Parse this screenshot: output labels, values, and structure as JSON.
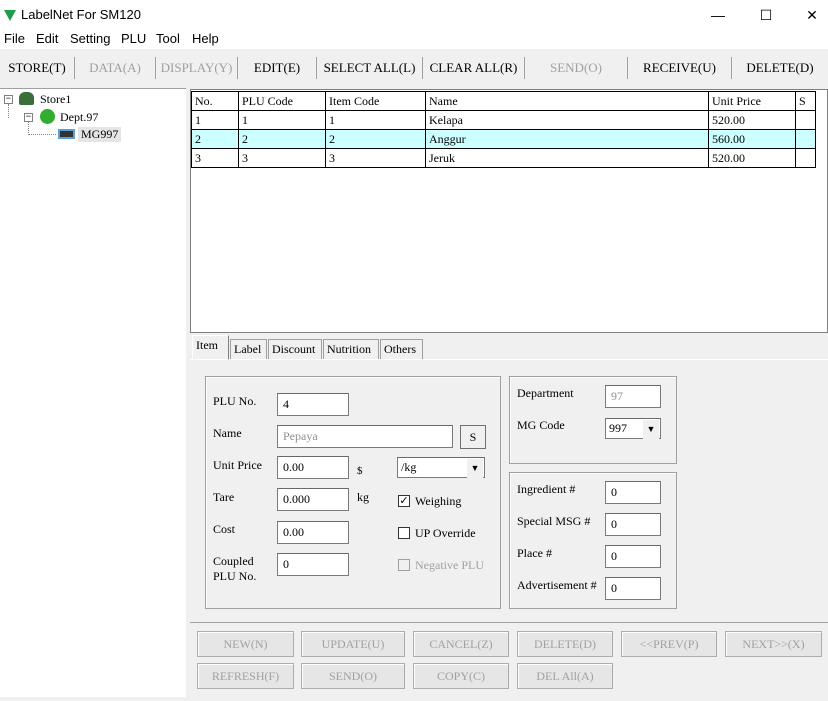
{
  "window": {
    "title": "LabelNet For SM120",
    "min": "—",
    "max": "☐",
    "close": "✕"
  },
  "menu": [
    "File",
    "Edit",
    "Setting",
    "PLU",
    "Tool",
    "Help"
  ],
  "toolbar": {
    "store": "STORE(T)",
    "data": "DATA(A)",
    "display": "DISPLAY(Y)",
    "edit": "EDIT(E)",
    "select_all": "SELECT ALL(L)",
    "clear_all": "CLEAR ALL(R)",
    "send": "SEND(O)",
    "receive": "RECEIVE(U)",
    "delete": "DELETE(D)"
  },
  "tree": {
    "store": "Store1",
    "dept": "Dept.97",
    "mg": "MG997"
  },
  "table": {
    "headers": [
      "No.",
      "PLU Code",
      "Item Code",
      "Name",
      "Unit Price",
      "S"
    ],
    "rows": [
      [
        "1",
        "1",
        "1",
        "Kelapa",
        "520.00",
        ""
      ],
      [
        "2",
        "2",
        "2",
        "Anggur",
        "560.00",
        ""
      ],
      [
        "3",
        "3",
        "3",
        "Jeruk",
        "520.00",
        ""
      ]
    ],
    "selected_row": 1,
    "selected_color": "#ccffff"
  },
  "tabs": [
    "Item",
    "Label",
    "Discount",
    "Nutrition",
    "Others"
  ],
  "form": {
    "plu_no_label": "PLU No.",
    "plu_no": "4",
    "name_label": "Name",
    "name": "Pepaya",
    "name_s": "S",
    "unit_price_label": "Unit Price",
    "unit_price": "0.00",
    "currency": "$",
    "unit": "/kg",
    "tare_label": "Tare",
    "tare": "0.000",
    "tare_unit": "kg",
    "cost_label": "Cost",
    "cost": "0.00",
    "coupled_label_1": "Coupled",
    "coupled_label_2": "PLU No.",
    "coupled": "0",
    "weighing_label": "Weighing",
    "weighing_checked": true,
    "check_mark": "✓",
    "up_override_label": "UP Override",
    "up_override_checked": false,
    "negative_plu_label": "Negative PLU",
    "negative_plu_checked": false
  },
  "dept": {
    "department_label": "Department",
    "department": "97",
    "mg_code_label": "MG Code",
    "mg_code": "997"
  },
  "extra": {
    "ingredient_label": "Ingredient #",
    "ingredient": "0",
    "special_msg_label": "Special MSG #",
    "special_msg": "0",
    "place_label": "Place #",
    "place": "0",
    "advertisement_label": "Advertisement #",
    "advertisement": "0"
  },
  "buttons": {
    "new": "NEW(N)",
    "update": "UPDATE(U)",
    "cancel": "CANCEL(Z)",
    "delete": "DELETE(D)",
    "prev": "<<PREV(P)",
    "next": "NEXT>>(X)",
    "refresh": "REFRESH(F)",
    "send": "SEND(O)",
    "copy": "COPY(C)",
    "del_all": "DEL All(A)"
  }
}
